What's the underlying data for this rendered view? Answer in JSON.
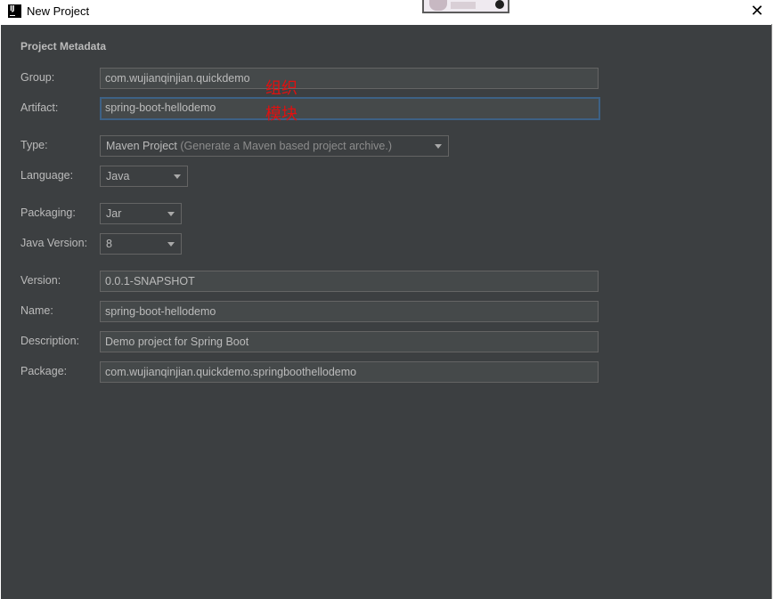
{
  "window": {
    "title": "New Project",
    "close_symbol": "✕"
  },
  "section": {
    "title": "Project Metadata"
  },
  "form": {
    "group": {
      "label": "Group:",
      "value": "com.wujianqinjian.quickdemo"
    },
    "artifact": {
      "label": "Artifact:",
      "value": "spring-boot-hellodemo"
    },
    "type": {
      "label": "Type:",
      "value": "Maven Project",
      "hint": " (Generate a Maven based project archive.)"
    },
    "language": {
      "label": "Language:",
      "value": "Java"
    },
    "packaging": {
      "label": "Packaging:",
      "value": "Jar"
    },
    "java_version": {
      "label": "Java Version:",
      "value": "8"
    },
    "version": {
      "label": "Version:",
      "value": "0.0.1-SNAPSHOT"
    },
    "name": {
      "label": "Name:",
      "value": "spring-boot-hellodemo"
    },
    "description": {
      "label": "Description:",
      "value": "Demo project for Spring Boot"
    },
    "package": {
      "label": "Package:",
      "value": "com.wujianqinjian.quickdemo.springboothellodemo"
    }
  },
  "annotations": {
    "line1": "组织",
    "line2": "模块"
  },
  "colors": {
    "background": "#3c3f41",
    "field_background": "#45494a",
    "text": "#bbbbbb",
    "focus_border": "#3d6185",
    "annotation": "#e01010"
  },
  "icons": {
    "app": "intellij-idea-icon",
    "close": "close-icon",
    "dropdown": "chevron-down-icon"
  }
}
